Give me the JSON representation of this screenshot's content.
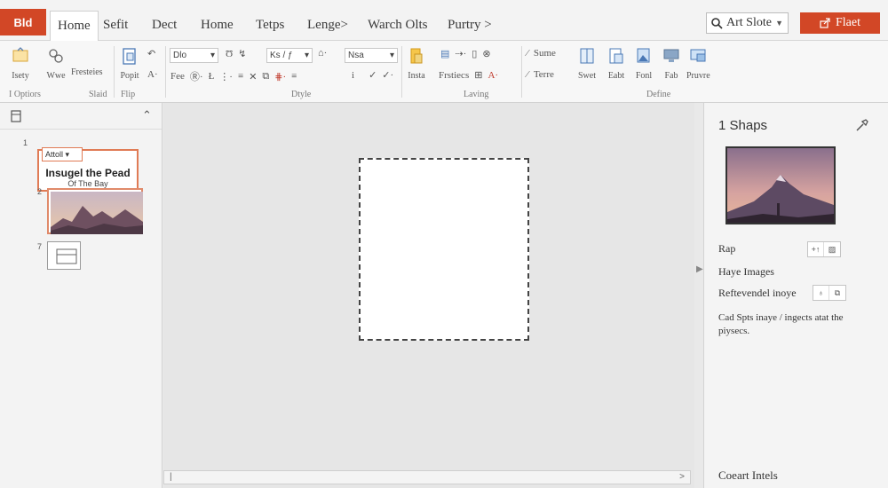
{
  "app_badge": "Bld",
  "tabs": [
    "Home",
    "Sefit",
    "Dect",
    "Home",
    "Tetps",
    "Lenge>",
    "Warch Olts",
    "Purtry >"
  ],
  "search": {
    "label": "Art Slote"
  },
  "share_button": {
    "label": "Flaet"
  },
  "ribbon": {
    "buttons": {
      "new": "Isety",
      "wire": "Wwe",
      "freshes": "Fresteies",
      "paste": "Popit",
      "insert_tab": "Insta",
      "freaks": "Frstiecs",
      "sped": "Swet",
      "edit": "Eabt",
      "font": "Fonl",
      "fab": "Fab",
      "prove": "Pruvre"
    },
    "font_name": "Dlo",
    "font_size": "Nsa",
    "effect_dd": "Ks / ƒ",
    "frame_label": "Fee",
    "scene_label": "Sume",
    "terre_label": "Terre",
    "indent": "i",
    "groups": {
      "options": "I Optiors",
      "slaid": "Slaid",
      "flip": "Flip",
      "style": "Dtyle",
      "laving": "Laving",
      "define": "Define"
    }
  },
  "thumbnails": {
    "slide1": {
      "num": "1",
      "badge": "Attoll",
      "title": "Insugel the Pead",
      "subtitle": "Of The Bay"
    },
    "slide2": {
      "num": "2"
    },
    "slide3": {
      "num": "7"
    }
  },
  "right_pane": {
    "title": "1 Shaps",
    "map_label": "Rap",
    "have_images_label": "Haye Images",
    "retrieved_label": "Reftevendel inoye",
    "description": "Cad Spts inaye / ingects atat the piysecs.",
    "footer": "Coeart Intels"
  },
  "colors": {
    "accent": "#d24726",
    "selection": "#e07b55"
  }
}
